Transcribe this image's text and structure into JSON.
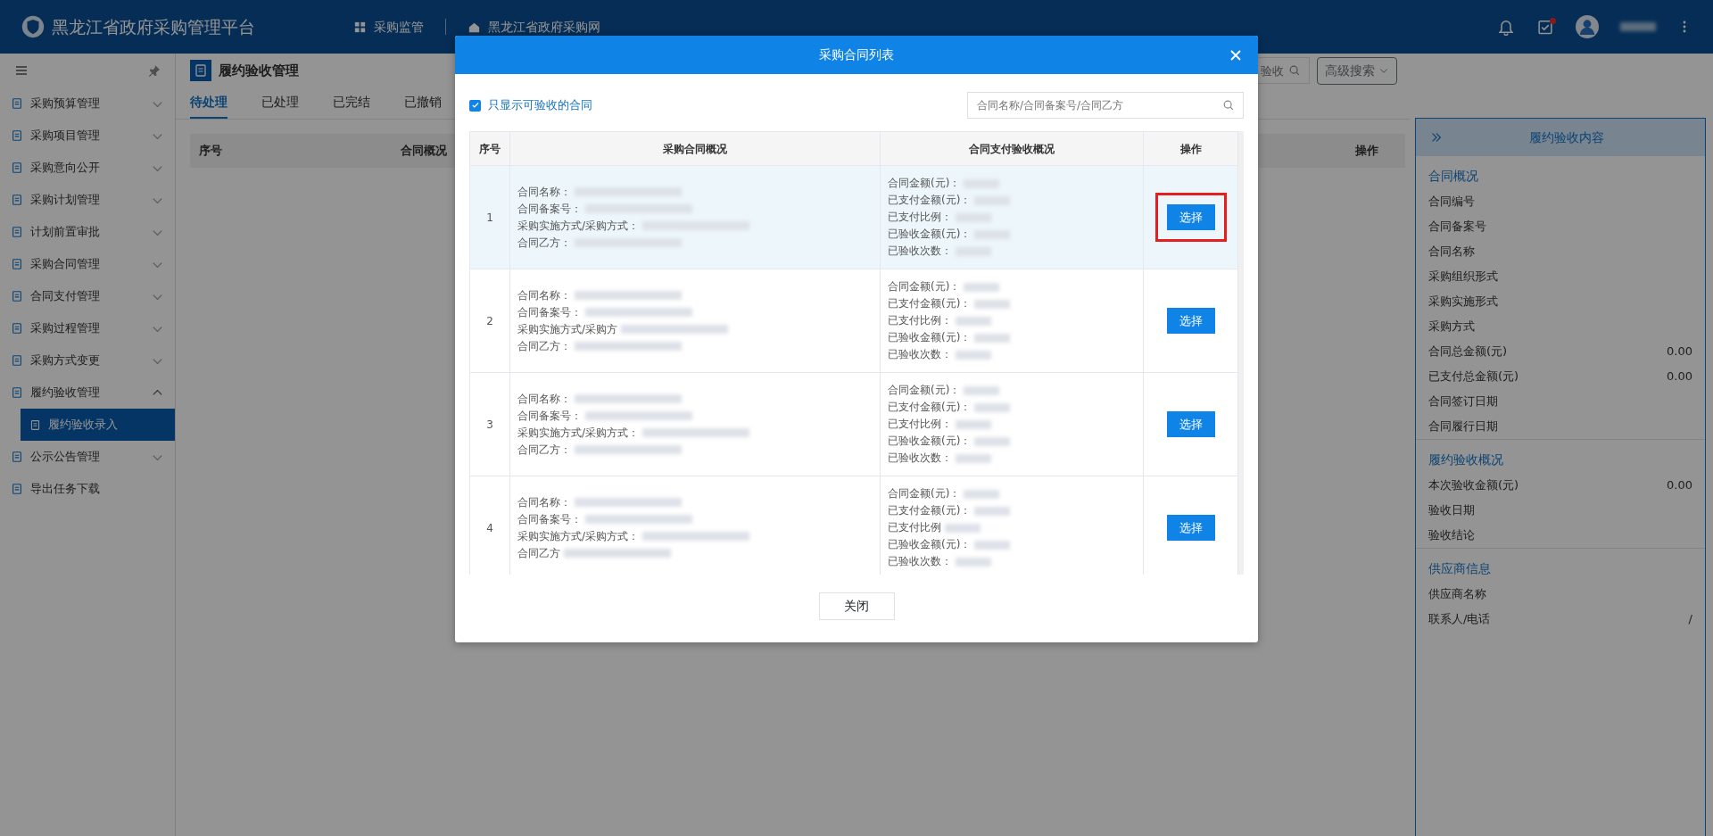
{
  "topbar": {
    "title": "黑龙江省政府采购管理平台",
    "nav": [
      {
        "label": "采购监管",
        "kind": "grid"
      },
      {
        "label": "黑龙江省政府采购网",
        "kind": "home"
      }
    ],
    "task_badge": true
  },
  "sidebar": {
    "items": [
      {
        "label": "采购预算管理",
        "kind": "group",
        "expanded": false
      },
      {
        "label": "采购项目管理",
        "kind": "group",
        "expanded": false
      },
      {
        "label": "采购意向公开",
        "kind": "group",
        "expanded": false
      },
      {
        "label": "采购计划管理",
        "kind": "group",
        "expanded": false
      },
      {
        "label": "计划前置审批",
        "kind": "group",
        "expanded": false
      },
      {
        "label": "采购合同管理",
        "kind": "group",
        "expanded": false
      },
      {
        "label": "合同支付管理",
        "kind": "group",
        "expanded": false
      },
      {
        "label": "采购过程管理",
        "kind": "group",
        "expanded": false
      },
      {
        "label": "采购方式变更",
        "kind": "group",
        "expanded": false
      },
      {
        "label": "履约验收管理",
        "kind": "group",
        "expanded": true,
        "children": [
          {
            "label": "履约验收录入",
            "selected": true
          }
        ]
      },
      {
        "label": "公示公告管理",
        "kind": "group",
        "expanded": false
      },
      {
        "label": "导出任务下载",
        "kind": "link"
      }
    ]
  },
  "page": {
    "title": "履约验收管理",
    "tabs": [
      {
        "label": "待处理",
        "selected": true
      },
      {
        "label": "已处理",
        "selected": false
      },
      {
        "label": "已完结",
        "selected": false
      },
      {
        "label": "已撤销",
        "selected": false
      }
    ],
    "search": {
      "placeholder": "验收"
    },
    "advanced_button": "高级搜索",
    "table": {
      "columns": [
        "序号",
        "合同概况",
        "操作"
      ]
    }
  },
  "modal": {
    "title": "采购合同列表",
    "filter": {
      "label": "只显示可验收的合同",
      "checked": true
    },
    "search": {
      "placeholder": "合同名称/合同备案号/合同乙方"
    },
    "columns": [
      "序号",
      "采购合同概况",
      "合同支付验收概况",
      "操作"
    ],
    "rows": [
      {
        "index": "1",
        "selected": true,
        "marked": true,
        "contract": [
          "合同名称：",
          "合同备案号：",
          "采购实施方式/采购方式：",
          "合同乙方："
        ],
        "payment": [
          "合同金额(元)：",
          "已支付金额(元)：",
          "已支付比例：",
          "已验收金额(元)：",
          "已验收次数："
        ],
        "action": "选择"
      },
      {
        "index": "2",
        "selected": false,
        "marked": false,
        "contract": [
          "合同名称：",
          "合同备案号：",
          "采购实施方式/采购方",
          "合同乙方："
        ],
        "payment": [
          "合同金额(元)：",
          "已支付金额(元)：",
          "已支付比例：",
          "已验收金额(元)：",
          "已验收次数："
        ],
        "action": "选择"
      },
      {
        "index": "3",
        "selected": false,
        "marked": false,
        "contract": [
          "合同名称：",
          "合同备案号：",
          "采购实施方式/采购方式：",
          "合同乙方："
        ],
        "payment": [
          "合同金额(元)：",
          "已支付金额(元)：",
          "已支付比例：",
          "已验收金额(元)：",
          "已验收次数："
        ],
        "action": "选择"
      },
      {
        "index": "4",
        "selected": false,
        "marked": false,
        "contract": [
          "合同名称：",
          "合同备案号：",
          "采购实施方式/采购方式：",
          "合同乙方"
        ],
        "payment": [
          "合同金额(元)：",
          "已支付金额(元)：",
          "已支付比例",
          "已验收金额(元)：",
          "已验收次数："
        ],
        "action": "选择"
      }
    ],
    "close_button": "关闭"
  },
  "detail_panel": {
    "title": "履约验收内容",
    "sections": [
      {
        "title": "合同概况",
        "fields": [
          {
            "label": "合同编号"
          },
          {
            "label": "合同备案号"
          },
          {
            "label": "合同名称"
          },
          {
            "label": "采购组织形式"
          },
          {
            "label": "采购实施形式"
          },
          {
            "label": "采购方式"
          },
          {
            "label": "合同总金额(元)",
            "value": "0.00"
          },
          {
            "label": "已支付总金额(元)",
            "value": "0.00"
          },
          {
            "label": "合同签订日期"
          },
          {
            "label": "合同履行日期"
          }
        ]
      },
      {
        "title": "履约验收概况",
        "fields": [
          {
            "label": "本次验收金额(元)",
            "value": "0.00"
          },
          {
            "label": "验收日期"
          },
          {
            "label": "验收结论"
          }
        ]
      },
      {
        "title": "供应商信息",
        "fields": [
          {
            "label": "供应商名称"
          },
          {
            "label": "联系人/电话",
            "value": "/"
          }
        ]
      }
    ]
  }
}
